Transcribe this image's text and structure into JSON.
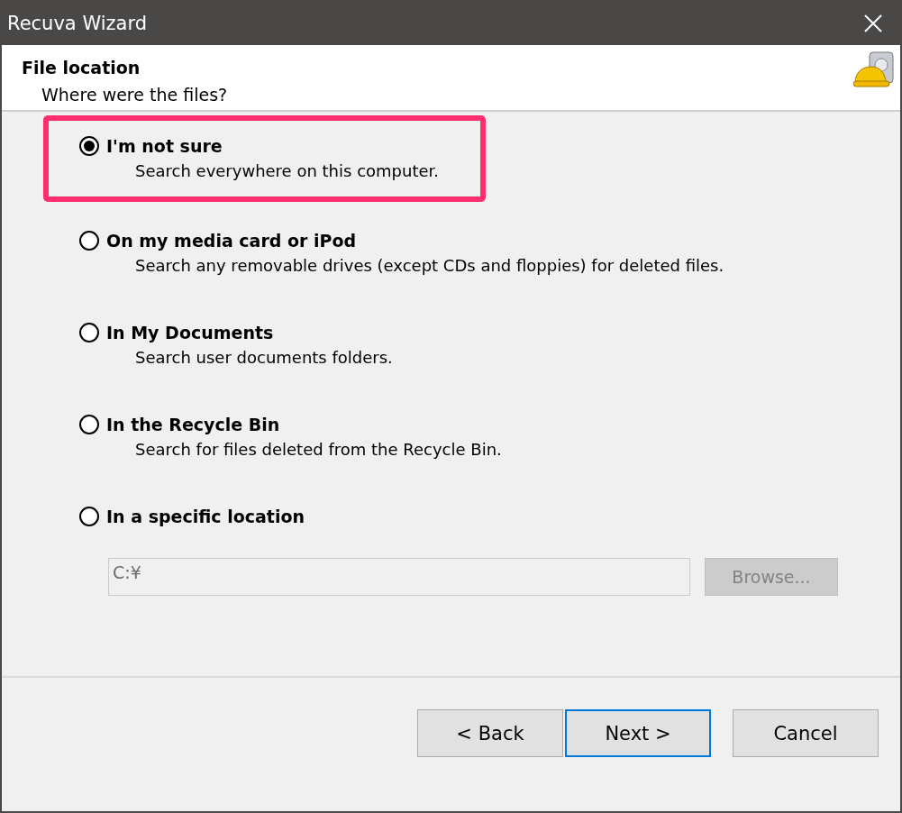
{
  "window": {
    "title": "Recuva Wizard"
  },
  "header": {
    "title": "File location",
    "subtitle": "Where were the files?"
  },
  "options": [
    {
      "label": "I'm not sure",
      "description": "Search everywhere on this computer.",
      "selected": true,
      "highlighted": true
    },
    {
      "label": "On my media card or iPod",
      "description": "Search any removable drives (except CDs and floppies) for deleted files.",
      "selected": false,
      "highlighted": false
    },
    {
      "label": "In My Documents",
      "description": "Search user documents folders.",
      "selected": false,
      "highlighted": false
    },
    {
      "label": "In the Recycle Bin",
      "description": "Search for files deleted from the Recycle Bin.",
      "selected": false,
      "highlighted": false
    },
    {
      "label": "In a specific location",
      "selected": false,
      "highlighted": false
    }
  ],
  "location": {
    "value": "C:¥",
    "disabled": true,
    "browse": {
      "label": "Browse...",
      "disabled": true
    }
  },
  "buttons": [
    {
      "label": "< Back",
      "default": false
    },
    {
      "label": "Next >",
      "default": true
    },
    {
      "label": "Cancel",
      "default": false
    }
  ]
}
